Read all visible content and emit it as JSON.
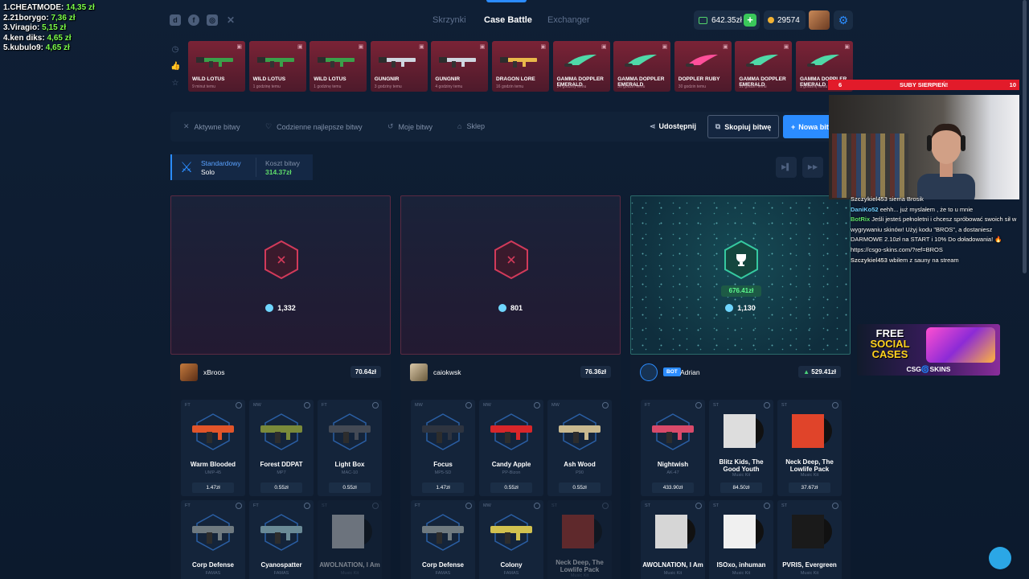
{
  "overlay_leaderboard": [
    {
      "name": "1.CHEATMODE:",
      "value": "14,35 zł"
    },
    {
      "name": "2.21borygo:",
      "value": "7,36 zł"
    },
    {
      "name": "3.Viragio:",
      "value": "5,15 zł"
    },
    {
      "name": "4.ken diks:",
      "value": "4,65 zł"
    },
    {
      "name": "5.kubulo9:",
      "value": "4,65 zł"
    }
  ],
  "nav": {
    "tabs": [
      "Skrzynki",
      "Case Battle",
      "Exchanger"
    ],
    "active": "Case Battle"
  },
  "wallet": {
    "balance": "642.35zł",
    "coins": "29574"
  },
  "live_drops": [
    {
      "name": "WILD LOTUS",
      "time": "9 minut temu"
    },
    {
      "name": "WILD LOTUS",
      "time": "1 godzinę temu"
    },
    {
      "name": "WILD LOTUS",
      "time": "1 godzinę temu"
    },
    {
      "name": "GUNGNIR",
      "time": "3 godziny temu"
    },
    {
      "name": "GUNGNIR",
      "time": "4 godziny temu"
    },
    {
      "name": "DRAGON LORE",
      "time": "16 godzin temu"
    },
    {
      "name": "GAMMA DOPPLER EMERALD",
      "time": "24 godziny temu"
    },
    {
      "name": "GAMMA DOPPLER EMERALD",
      "time": "30 godzin temu"
    },
    {
      "name": "DOPPLER RUBY",
      "time": "30 godzin temu"
    },
    {
      "name": "GAMMA DOPPLER EMERALD",
      "time": "31 godzin temu"
    },
    {
      "name": "GAMMA DOPPLER EMERALD",
      "time": "1 godzinę temu"
    }
  ],
  "battle_tabs": {
    "active_battles": "Aktywne bitwy",
    "daily_best": "Codzienne najlepsze bitwy",
    "my_battles": "Moje bitwy",
    "shop": "Sklep",
    "share": "Udostępnij",
    "copy": "Skopiuj bitwę",
    "new": "Nowa bitwa"
  },
  "mode": {
    "type": "Standardowy",
    "sub": "Solo",
    "cost_label": "Koszt bitwy",
    "cost": "314.37zł"
  },
  "players": [
    {
      "gems": "1,332",
      "name": "xBroos",
      "total": "70.64zł",
      "won": false
    },
    {
      "gems": "801",
      "name": "caiokwsk",
      "total": "76.36zł",
      "won": false
    },
    {
      "gems": "1,130",
      "name": "Adrian",
      "total": "529.41zł",
      "won": true,
      "win_amount": "676.41zł",
      "bot_label": "BOT"
    }
  ],
  "items": [
    [
      {
        "cond": "FT",
        "name": "Warm Blooded",
        "sub": "UMP-45",
        "price": "1.47zł",
        "color": "#e2552a"
      },
      {
        "cond": "MW",
        "name": "Forest DDPAT",
        "sub": "MP7",
        "price": "0.55zł",
        "color": "#7a8a3a"
      },
      {
        "cond": "FT",
        "name": "Light Box",
        "sub": "MAC-10",
        "price": "0.55zł",
        "color": "#444a55"
      },
      {
        "cond": "FT",
        "name": "Corp Defense",
        "sub": "FAMAS",
        "price": "",
        "color": "#6f7a80"
      },
      {
        "cond": "FT",
        "name": "Cyanospatter",
        "sub": "FAMAS",
        "price": "",
        "color": "#6a8a96"
      },
      {
        "cond": "ST",
        "name": "AWOLNATION, I Am",
        "sub": "Music Kit",
        "price": "",
        "color": "#ddd",
        "dim": true
      }
    ],
    [
      {
        "cond": "MW",
        "name": "Focus",
        "sub": "MP5-SD",
        "price": "1.47zł",
        "color": "#2e3440"
      },
      {
        "cond": "MW",
        "name": "Candy Apple",
        "sub": "PP-Bizon",
        "price": "0.55zł",
        "color": "#d8262a"
      },
      {
        "cond": "MW",
        "name": "Ash Wood",
        "sub": "P90",
        "price": "0.55zł",
        "color": "#c9b98f"
      },
      {
        "cond": "FT",
        "name": "Corp Defense",
        "sub": "FAMAS",
        "price": "",
        "color": "#6f7a80"
      },
      {
        "cond": "MW",
        "name": "Colony",
        "sub": "FAMAS",
        "price": "",
        "color": "#d1c14f"
      },
      {
        "cond": "ST",
        "name": "Neck Deep, The Lowlife Pack",
        "sub": "Music Kit",
        "price": "",
        "color": "#c03a2a",
        "dim": true
      }
    ],
    [
      {
        "cond": "FT",
        "name": "Nightwish",
        "sub": "AK-47",
        "price": "433.90zł",
        "color": "#d94a6a"
      },
      {
        "cond": "ST",
        "name": "Blitz Kids, The Good Youth",
        "sub": "Music Kit",
        "price": "84.50zł",
        "color": "#dddddd"
      },
      {
        "cond": "ST",
        "name": "Neck Deep, The Lowlife Pack",
        "sub": "Music Kit",
        "price": "37.67zł",
        "color": "#e0442a"
      },
      {
        "cond": "ST",
        "name": "AWOLNATION, I Am",
        "sub": "Music Kit",
        "price": "",
        "color": "#d6d6d6"
      },
      {
        "cond": "ST",
        "name": "ISOxo, inhuman",
        "sub": "Music Kit",
        "price": "",
        "color": "#f0f0f0"
      },
      {
        "cond": "ST",
        "name": "PVRIS, Evergreen",
        "sub": "Music Kit",
        "price": "",
        "color": "#1a1a1a"
      }
    ]
  ],
  "stream": {
    "subbar": {
      "left": "6",
      "center": "SUBY SIERPIEŃ!",
      "right": "10"
    },
    "chat": [
      {
        "user": "Szczykiel453",
        "msg": "siema Brosik",
        "color": "#d8d8d8"
      },
      {
        "user": "DaniKo52",
        "msg": "eehh... już myslałem , że to u mnie",
        "color": "#6fd0ff"
      },
      {
        "user": "BotRix",
        "msg": "Jeśli jesteś pełnoletni i chcesz spróbować swoich sił w wygrywaniu skinów! Użyj kodu \"BROS\", a dostaniesz DARMOWE 2.10zł na START i 10% Do doładowania! 🔥 https://csgo-skins.com/?ref=BROS",
        "color": "#5fe36a"
      },
      {
        "user": "Szczykiel453",
        "msg": "wbilem z sauny na stream",
        "color": "#d8d8d8"
      }
    ],
    "ad": {
      "line1": "FREE",
      "line2": "SOCIAL",
      "line3": "CASES",
      "brand": "CSG🌀SKINS"
    }
  }
}
